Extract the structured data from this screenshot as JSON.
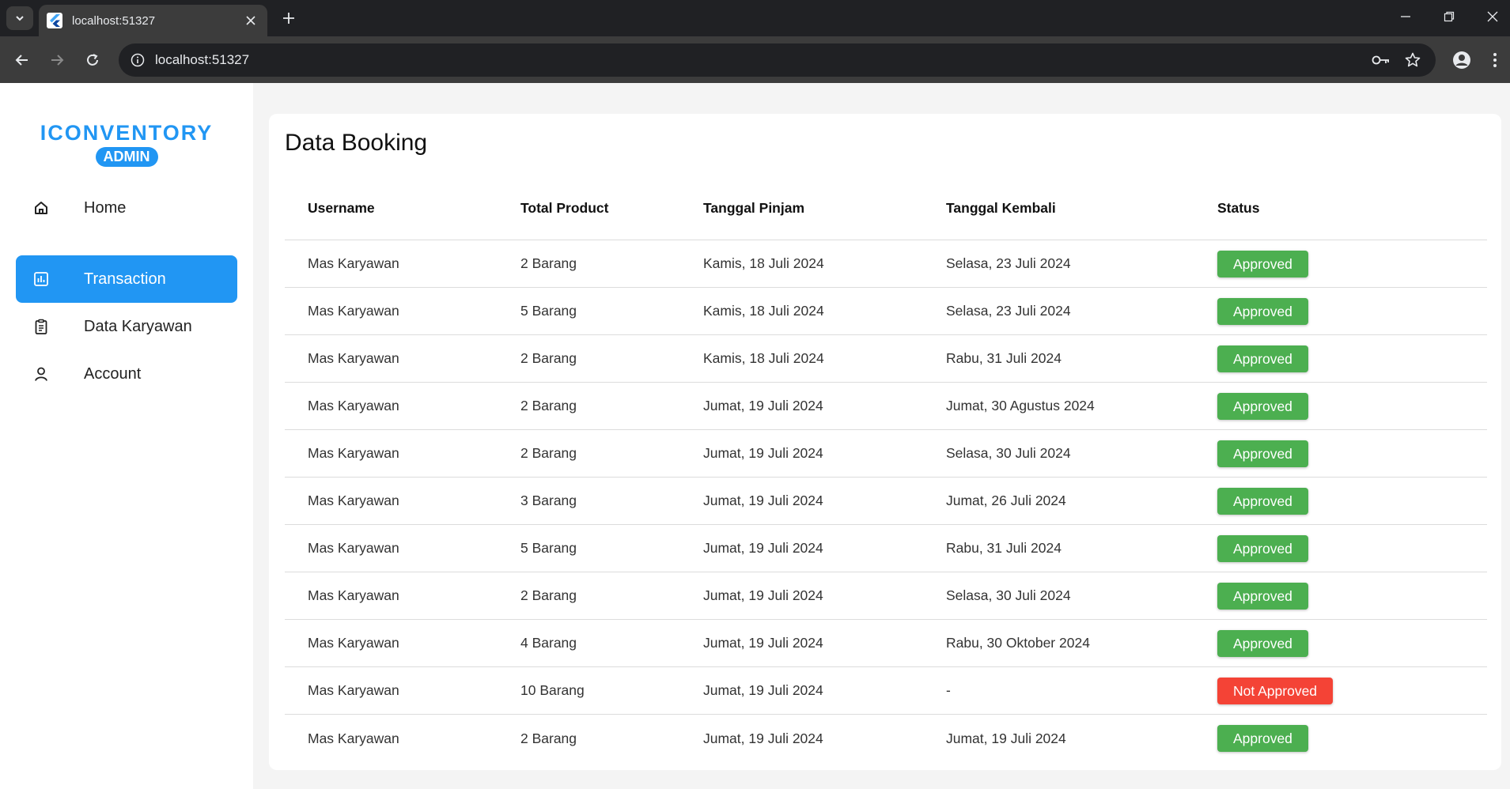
{
  "browser": {
    "tab_title": "localhost:51327",
    "url": "localhost:51327"
  },
  "sidebar": {
    "brand_title": "ICONVENTORY",
    "brand_badge": "ADMIN",
    "items": [
      {
        "label": "Home",
        "icon": "home-icon",
        "active": false
      },
      {
        "label": "Transaction",
        "icon": "chart-icon",
        "active": true
      },
      {
        "label": "Data Karyawan",
        "icon": "clipboard-icon",
        "active": false
      },
      {
        "label": "Account",
        "icon": "person-icon",
        "active": false
      }
    ]
  },
  "main": {
    "title": "Data Booking",
    "columns": [
      "Username",
      "Total Product",
      "Tanggal Pinjam",
      "Tanggal Kembali",
      "Status"
    ],
    "rows": [
      {
        "username": "Mas Karyawan",
        "total": "2 Barang",
        "pinjam": "Kamis, 18 Juli 2024",
        "kembali": "Selasa, 23 Juli 2024",
        "status": "Approved"
      },
      {
        "username": "Mas Karyawan",
        "total": "5 Barang",
        "pinjam": "Kamis, 18 Juli 2024",
        "kembali": "Selasa, 23 Juli 2024",
        "status": "Approved"
      },
      {
        "username": "Mas Karyawan",
        "total": "2 Barang",
        "pinjam": "Kamis, 18 Juli 2024",
        "kembali": "Rabu, 31 Juli 2024",
        "status": "Approved"
      },
      {
        "username": "Mas Karyawan",
        "total": "2 Barang",
        "pinjam": "Jumat, 19 Juli 2024",
        "kembali": "Jumat, 30 Agustus 2024",
        "status": "Approved"
      },
      {
        "username": "Mas Karyawan",
        "total": "2 Barang",
        "pinjam": "Jumat, 19 Juli 2024",
        "kembali": "Selasa, 30 Juli 2024",
        "status": "Approved"
      },
      {
        "username": "Mas Karyawan",
        "total": "3 Barang",
        "pinjam": "Jumat, 19 Juli 2024",
        "kembali": "Jumat, 26 Juli 2024",
        "status": "Approved"
      },
      {
        "username": "Mas Karyawan",
        "total": "5 Barang",
        "pinjam": "Jumat, 19 Juli 2024",
        "kembali": "Rabu, 31 Juli 2024",
        "status": "Approved"
      },
      {
        "username": "Mas Karyawan",
        "total": "2 Barang",
        "pinjam": "Jumat, 19 Juli 2024",
        "kembali": "Selasa, 30 Juli 2024",
        "status": "Approved"
      },
      {
        "username": "Mas Karyawan",
        "total": "4 Barang",
        "pinjam": "Jumat, 19 Juli 2024",
        "kembali": "Rabu, 30 Oktober 2024",
        "status": "Approved"
      },
      {
        "username": "Mas Karyawan",
        "total": "10 Barang",
        "pinjam": "Jumat, 19 Juli 2024",
        "kembali": "-",
        "status": "Not Approved"
      },
      {
        "username": "Mas Karyawan",
        "total": "2 Barang",
        "pinjam": "Jumat, 19 Juli 2024",
        "kembali": "Jumat, 19 Juli 2024",
        "status": "Approved"
      }
    ]
  },
  "colors": {
    "accent": "#2196f3",
    "approved": "#4caf50",
    "not_approved": "#f44336"
  }
}
